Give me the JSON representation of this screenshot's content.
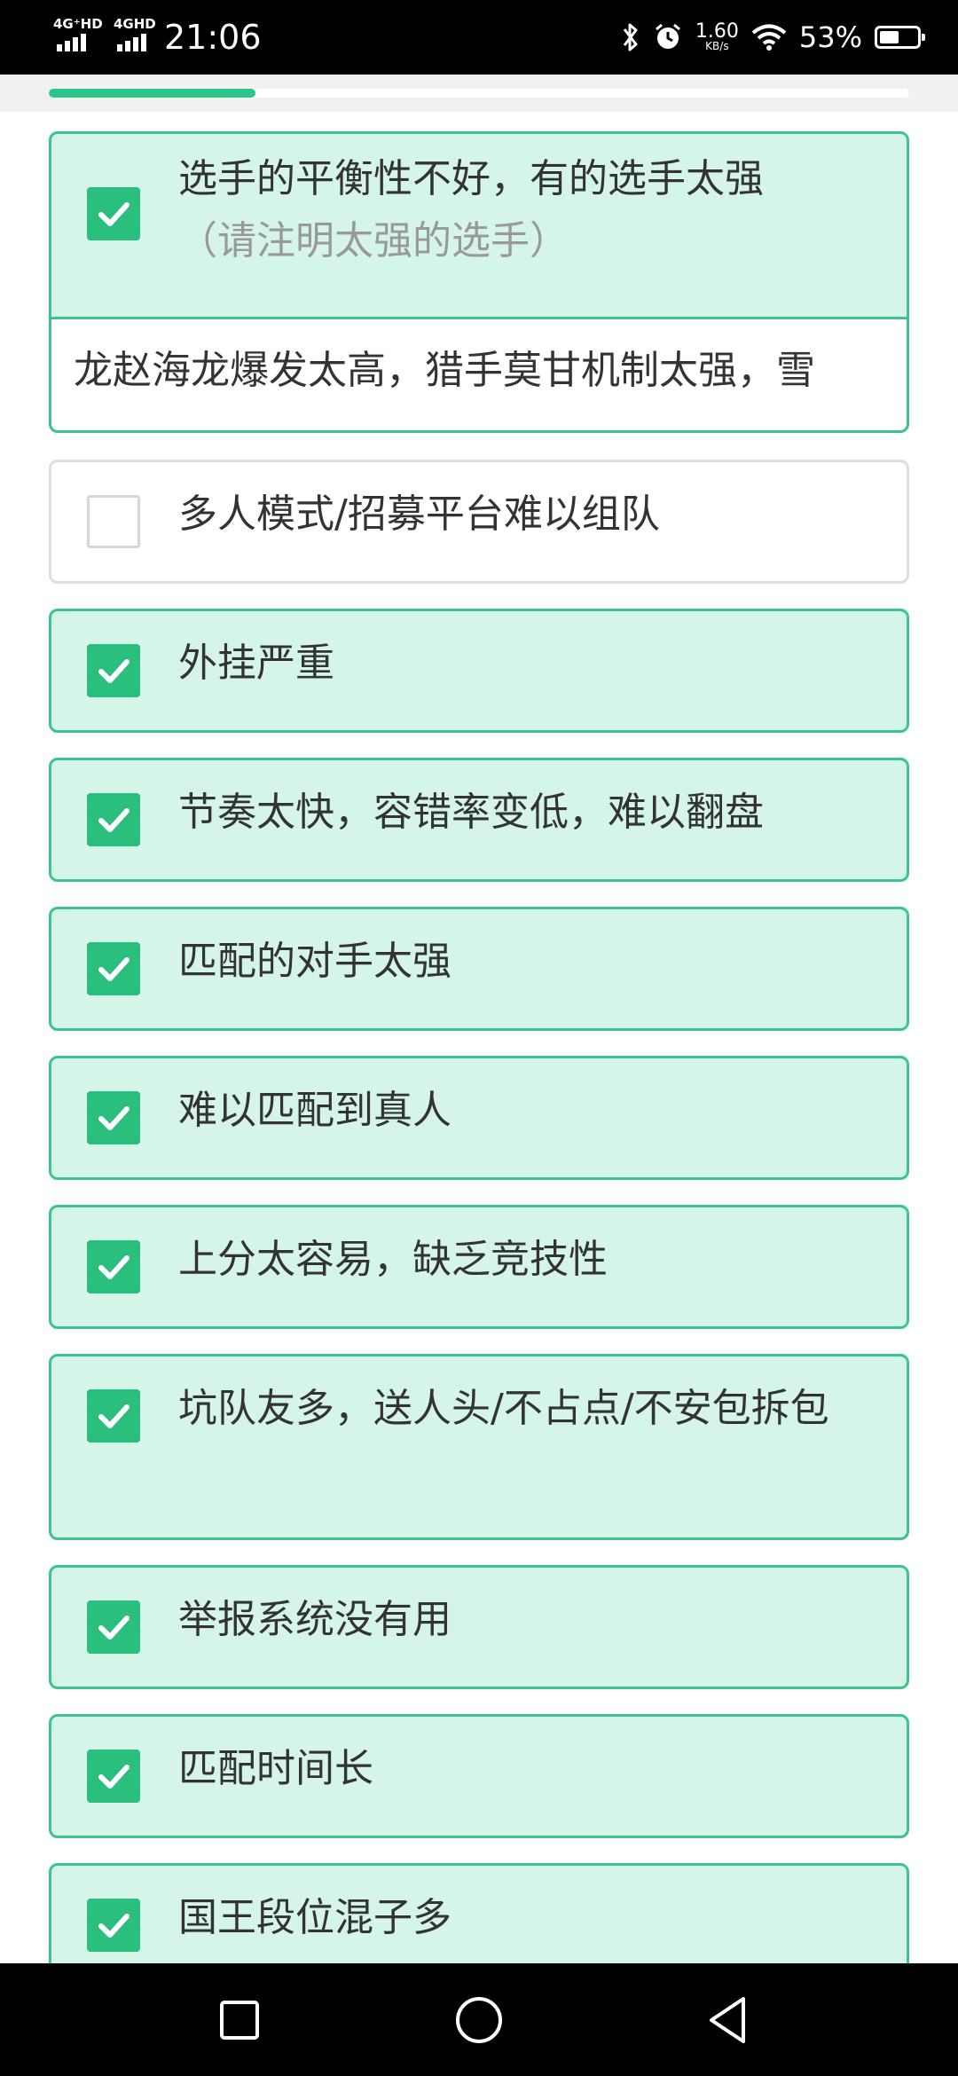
{
  "status_bar": {
    "sim1_label": "4G⁺HD",
    "sim2_label": "4GHD",
    "time": "21:06",
    "net_speed": "1.60",
    "net_speed_unit": "KB/s",
    "battery": "53%",
    "battery_level": 0.53
  },
  "survey": {
    "progress": 0.24,
    "options": [
      {
        "label": "选手的平衡性不好，有的选手太强",
        "hint": "（请注明太强的选手）",
        "checked": true,
        "note": "龙赵海龙爆发太高，猎手莫甘机制太强，雪"
      },
      {
        "label": "多人模式/招募平台难以组队",
        "checked": false
      },
      {
        "label": "外挂严重",
        "checked": true
      },
      {
        "label": "节奏太快，容错率变低，难以翻盘",
        "checked": true
      },
      {
        "label": "匹配的对手太强",
        "checked": true
      },
      {
        "label": "难以匹配到真人",
        "checked": true
      },
      {
        "label": "上分太容易，缺乏竞技性",
        "checked": true
      },
      {
        "label": "坑队友多，送人头/不占点/不安包拆包",
        "checked": true
      },
      {
        "label": "举报系统没有用",
        "checked": true
      },
      {
        "label": "匹配时间长",
        "checked": true
      },
      {
        "label": "国王段位混子多",
        "checked": true
      }
    ]
  },
  "nav_bar": {
    "recents_icon": "square-icon",
    "home_icon": "circle-icon",
    "back_icon": "triangle-back-icon"
  }
}
